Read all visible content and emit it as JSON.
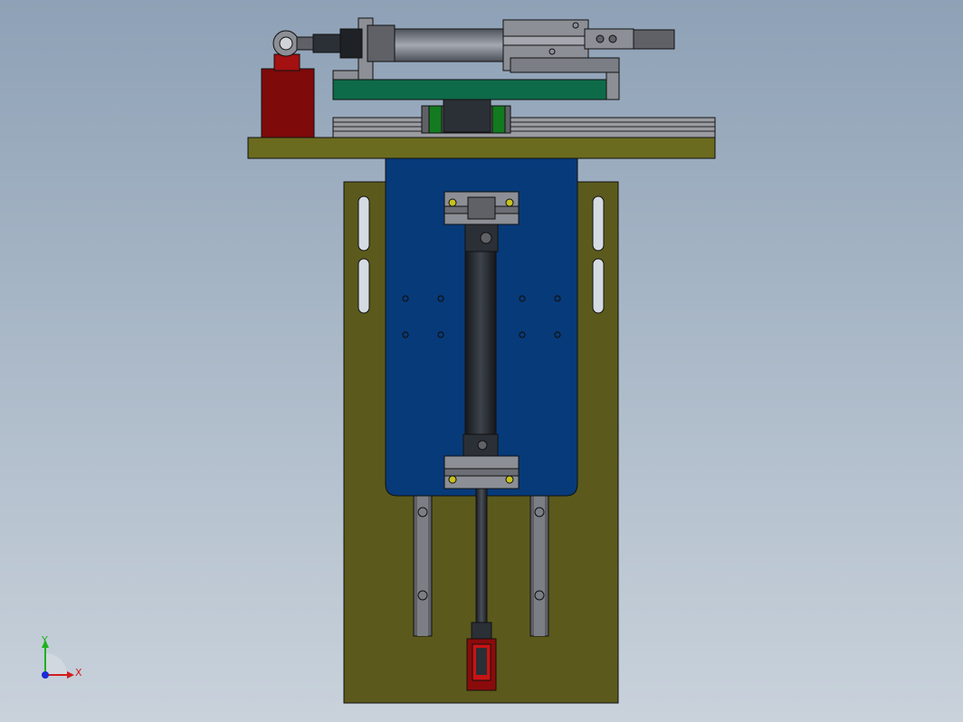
{
  "viewport": {
    "background_top": "#8ea1b6",
    "background_bottom": "#c9d2db"
  },
  "triad": {
    "y_label": "Y",
    "x_label": "X",
    "y_color": "#1db31d",
    "x_color": "#d11d1d",
    "origin_color": "#1b2bd6"
  },
  "colors": {
    "olive_plate": "#5b5a1c",
    "blue_plate": "#073a79",
    "red_block": "#7e0a0a",
    "green_plate": "#0e6b4a",
    "dark_steel": "#2b2f36",
    "grey_steel": "#8c8f95"
  },
  "parts": [
    "base-plate",
    "carriage-plate",
    "vertical-cylinder",
    "horizontal-cylinder",
    "linear-guide-rail",
    "mounting-block",
    "guide-rails",
    "bottom-clevis"
  ]
}
